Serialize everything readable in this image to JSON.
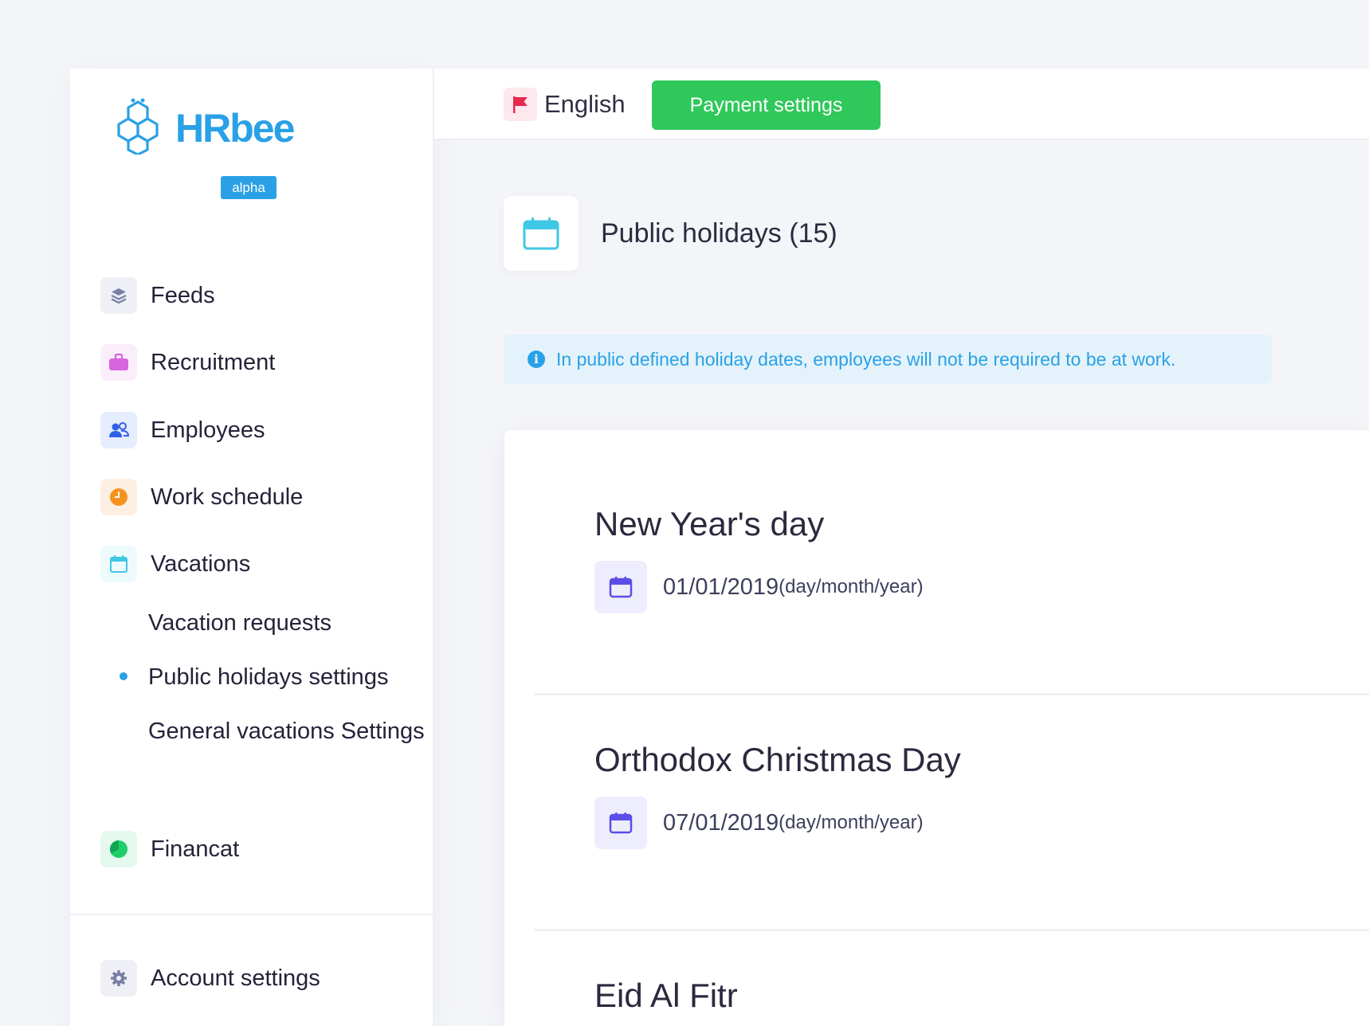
{
  "brand": {
    "name": "HRbee",
    "badge": "alpha",
    "color": "#2aa1e6"
  },
  "topbar": {
    "language": "English",
    "flag_icon": "flag-icon",
    "payment_button": "Payment settings"
  },
  "nav": {
    "items": [
      {
        "label": "Feeds",
        "icon": "layers-icon"
      },
      {
        "label": "Recruitment",
        "icon": "briefcase-icon"
      },
      {
        "label": "Employees",
        "icon": "users-icon"
      },
      {
        "label": "Work schedule",
        "icon": "clock-icon"
      },
      {
        "label": "Vacations",
        "icon": "calendar-icon"
      },
      {
        "label": "Financat",
        "icon": "pie-chart-icon"
      }
    ],
    "vacations_sub": [
      {
        "label": "Vacation requests",
        "active": false
      },
      {
        "label": "Public holidays settings",
        "active": true
      },
      {
        "label": "General vacations Settings",
        "active": false
      }
    ],
    "account": {
      "label": "Account settings",
      "icon": "gear-icon"
    }
  },
  "page": {
    "title": "Public holidays (15)",
    "info": "In public defined holiday dates, employees will not be required to be at work."
  },
  "holidays": [
    {
      "name": "New Year's day",
      "date": "01/01/2019",
      "format": "(day/month/year)"
    },
    {
      "name": "Orthodox Christmas Day",
      "date": "07/01/2019",
      "format": "(day/month/year)"
    },
    {
      "name": "Eid Al Fitr",
      "date": "",
      "format": ""
    }
  ]
}
